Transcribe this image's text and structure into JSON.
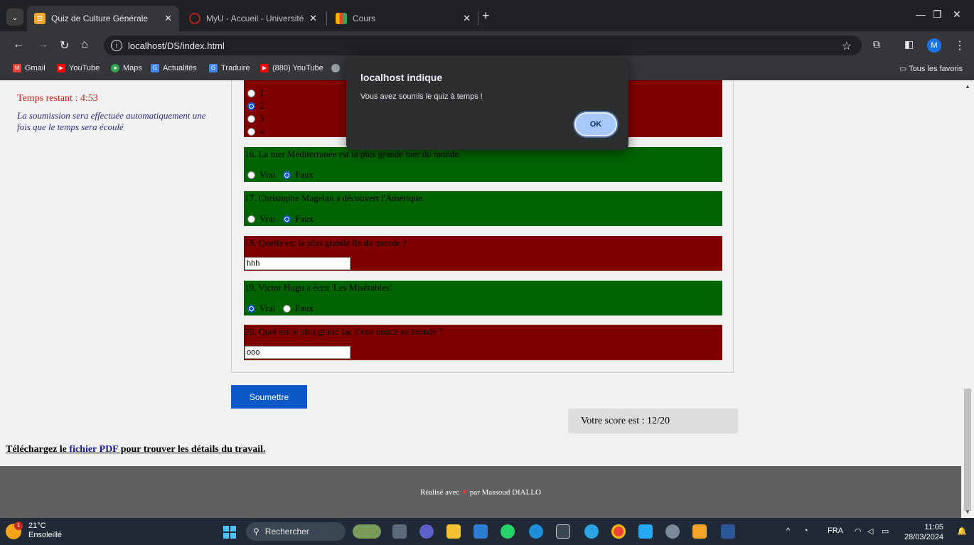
{
  "browser": {
    "tabs": [
      {
        "title": "Quiz de Culture Générale",
        "active": true
      },
      {
        "title": "MyU - Accueil - Université Cent",
        "active": false
      },
      {
        "title": "Cours",
        "active": false
      }
    ],
    "url": "localhost/DS/index.html",
    "bookmarks": [
      "Gmail",
      "YouTube",
      "Maps",
      "Actualités",
      "Traduire",
      "(880) YouTube"
    ],
    "all_bookmarks": "Tous les favoris",
    "profile_initial": "M"
  },
  "page": {
    "timer": "Temps restant : 4:53",
    "auto_note": "La soumission sera effectuée automatiquement une fois que le temps sera écoulé",
    "q15_options": [
      "1",
      "2",
      "3",
      "4"
    ],
    "questions": [
      {
        "text": "16. La mer Méditerranée est la plus grande mer du monde.",
        "options": [
          "Vrai",
          "Faux"
        ],
        "selected": "Faux",
        "status": "correct"
      },
      {
        "text": "17. Christophe Magelan a découvert l'Amérique.",
        "options": [
          "Vrai",
          "Faux"
        ],
        "selected": "Faux",
        "status": "correct"
      },
      {
        "text": "18. Quelle est la plus grande île du monde ?",
        "answer": "hhh",
        "status": "incorrect"
      },
      {
        "text": "19. Victor Hugo a écrit 'Les Misérables'.",
        "options": [
          "Vrai",
          "Faux"
        ],
        "selected": "Vrai",
        "status": "correct"
      },
      {
        "text": "20. Quel est le plus grand lac d'eau douce au monde ?",
        "answer": "ooo",
        "status": "incorrect"
      }
    ],
    "submit_label": "Soumettre",
    "score": "Votre score est : 12/20",
    "pdf_prefix": "Téléchargez le ",
    "pdf_link": "fichier PDF",
    "pdf_suffix": " pour trouver les détails du travail.",
    "footer_prefix": "Réalisé avec",
    "footer_suffix": "par Massoud DIALLO"
  },
  "dialog": {
    "title": "localhost indique",
    "message": "Vous avez soumis le quiz à temps !",
    "ok_label": "OK"
  },
  "taskbar": {
    "temperature": "21°C",
    "weather": "Ensoleillé",
    "weather_badge": "1",
    "search_placeholder": "Rechercher",
    "language": "FRA",
    "time": "11:05",
    "date": "28/03/2024"
  },
  "colors": {
    "correct": "#006400",
    "incorrect": "#800000",
    "submit": "#0b58c8"
  }
}
